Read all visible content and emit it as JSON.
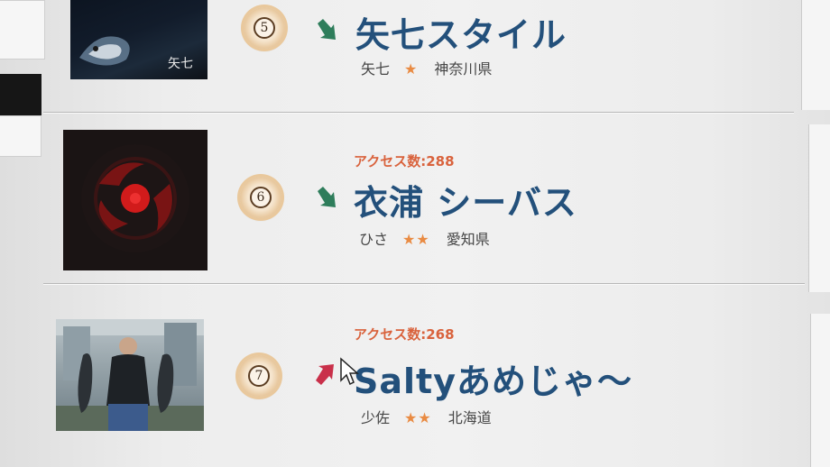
{
  "rankings": [
    {
      "rank": "5",
      "trend": "down",
      "trend_icon": "down-right-arrow-icon",
      "trend_color": "#2e7d5b",
      "access_label": "",
      "access_count": "",
      "title": "矢七スタイル",
      "author": "矢七",
      "stars": "★",
      "prefecture": "神奈川県",
      "thumb_caption": "矢七"
    },
    {
      "rank": "6",
      "trend": "down",
      "trend_icon": "down-right-arrow-icon",
      "trend_color": "#2e7d5b",
      "access_label": "アクセス数:",
      "access_count": "288",
      "title": "衣浦 シーバス",
      "author": "ひさ",
      "stars": "★★",
      "prefecture": "愛知県"
    },
    {
      "rank": "7",
      "trend": "up",
      "trend_icon": "up-right-arrow-icon",
      "trend_color": "#c9304a",
      "access_label": "アクセス数:",
      "access_count": "268",
      "title": "Saltyあめじゃ〜",
      "author": "少佐",
      "stars": "★★",
      "prefecture": "北海道"
    }
  ],
  "colors": {
    "title": "#23507b",
    "access": "#d9623c",
    "stars": "#e98b43",
    "up_arrow": "#c9304a",
    "down_arrow": "#2e7d5b"
  }
}
